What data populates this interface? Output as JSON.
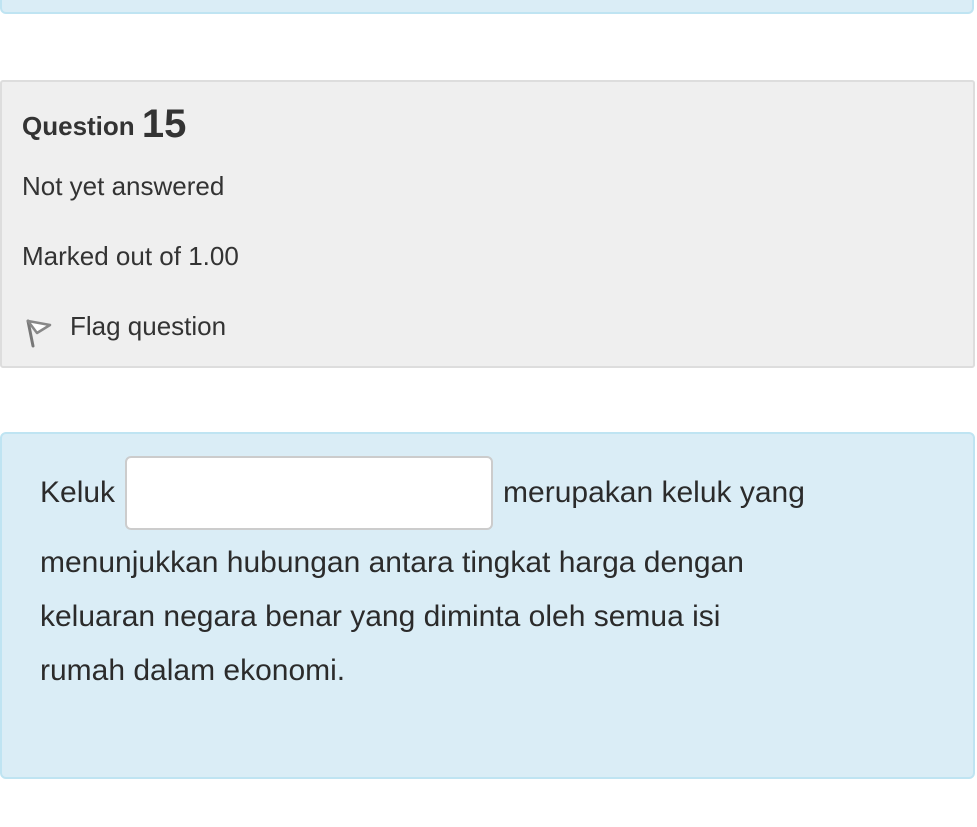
{
  "question": {
    "label": "Question",
    "number": "15",
    "state": "Not yet answered",
    "grade": "Marked out of 1.00",
    "flag_label": "Flag question"
  },
  "text": {
    "before_blank": "Keluk",
    "after_blank": "merupakan keluk yang",
    "line2": "menunjukkan hubungan antara tingkat harga dengan",
    "line3": "keluaran negara benar yang diminta oleh semua isi",
    "line4": "rumah dalam ekonomi."
  },
  "answer": {
    "value": "",
    "placeholder": ""
  },
  "icons": {
    "flag": "flag-icon"
  },
  "colors": {
    "info_bg": "#efefef",
    "content_bg": "#daedf6",
    "content_border": "#bfe4f2"
  }
}
